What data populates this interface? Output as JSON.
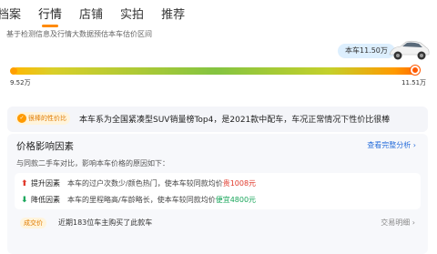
{
  "tabs": [
    {
      "label": "档案"
    },
    {
      "label": "行情"
    },
    {
      "label": "店铺"
    },
    {
      "label": "实拍"
    },
    {
      "label": "推荐"
    }
  ],
  "subtitle": "基于检测信息及行情大数据预估本车估价区间",
  "price_badge": "本车11.50万",
  "range": {
    "low_label": "9.52万",
    "high_label": "11.51万",
    "low": 9.52,
    "high": 11.51,
    "current": 11.5
  },
  "quote": {
    "badge": "很棒的性价比",
    "text": "本车系为全国紧凑型SUV销量榜Top4，是2021款中配车，车况正常情况下性价比很棒"
  },
  "factors": {
    "title": "价格影响因素",
    "link": "查看完整分析 ›",
    "subtitle": "与同款二手车对比，影响本车价格的原因如下：",
    "items": [
      {
        "arrow": "⬆",
        "name": "提升因素",
        "desc": "本车的过户次数少/颜色热门，使本车较同款均价",
        "highlight": "贵1008元"
      },
      {
        "arrow": "⬇",
        "name": "降低因素",
        "desc": "本车的里程略高/车龄略长，使本车较同款均价",
        "highlight": "便宜4800元"
      }
    ]
  },
  "deal": {
    "badge": "成交价",
    "text": "近期183位车主购买了此款车",
    "link": "交易明细 ›"
  },
  "colors": {
    "accent": "#ff8a00",
    "link": "#2a6fdb",
    "up": "#e03a2c",
    "down": "#1aa65b"
  }
}
